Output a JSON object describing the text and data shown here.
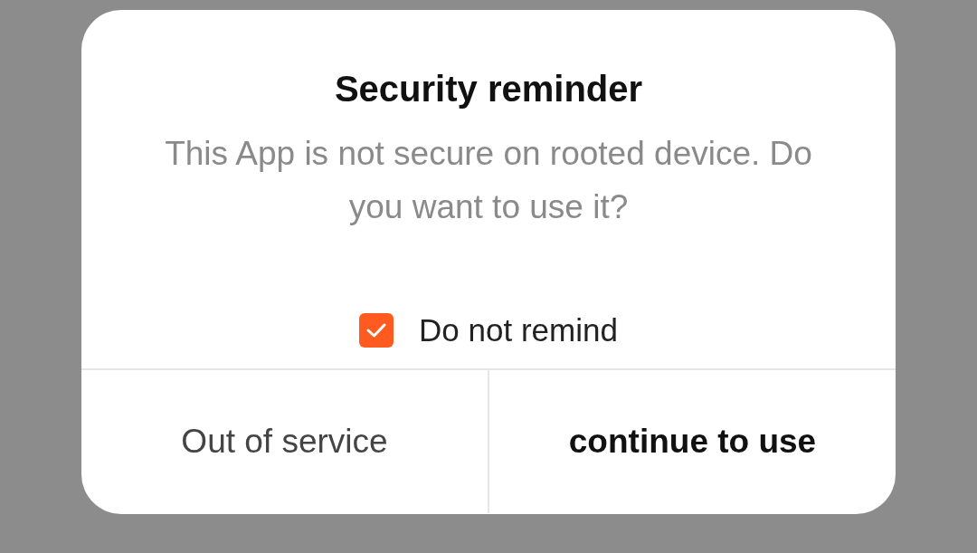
{
  "dialog": {
    "title": "Security reminder",
    "message": "This App is not secure on rooted device. Do you want to use it?",
    "checkbox": {
      "label": "Do not remind",
      "checked": true
    },
    "buttons": [
      {
        "label": "Out of service",
        "kind": "secondary"
      },
      {
        "label": "continue to use",
        "kind": "primary"
      }
    ]
  }
}
